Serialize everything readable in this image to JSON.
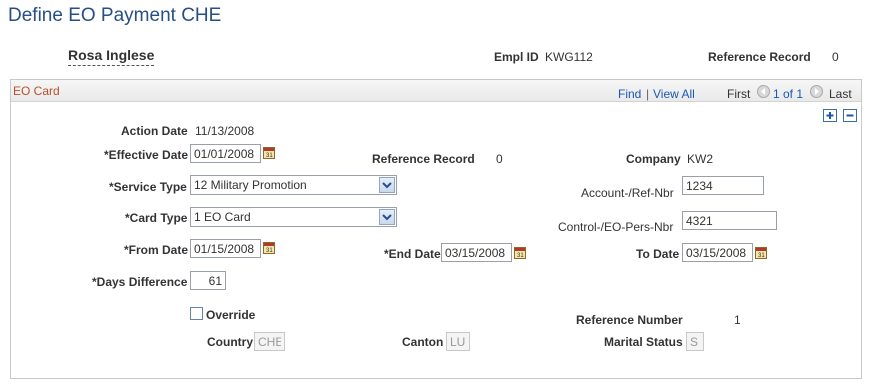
{
  "page": {
    "title": "Define EO Payment CHE"
  },
  "header": {
    "employee_name": "Rosa Inglese",
    "empl_id_label": "Empl ID",
    "empl_id_value": "KWG112",
    "reference_record_label": "Reference Record",
    "reference_record_value": "0"
  },
  "card": {
    "title": "EO Card",
    "find_label": "Find",
    "separator": "|",
    "view_all_label": "View All",
    "first_label": "First",
    "page_info": "1 of 1",
    "last_label": "Last",
    "icons": {
      "prev": "prev-arrow-icon",
      "next": "next-arrow-icon",
      "add": "plus-icon",
      "delete": "minus-icon",
      "calendar": "calendar-icon"
    }
  },
  "form": {
    "action_date": {
      "label": "Action Date",
      "value": "11/13/2008"
    },
    "effective_date": {
      "label": "*Effective Date",
      "value": "01/01/2008"
    },
    "reference_record": {
      "label": "Reference Record",
      "value": "0"
    },
    "company": {
      "label": "Company",
      "value": "KW2"
    },
    "service_type": {
      "label": "*Service Type",
      "value": "12 Military Promotion"
    },
    "account_ref_nbr": {
      "label": "Account-/Ref-Nbr",
      "value": "1234"
    },
    "card_type": {
      "label": "*Card Type",
      "value": "1 EO Card"
    },
    "control_eo_pers_nbr": {
      "label": "Control-/EO-Pers-Nbr",
      "value": "4321"
    },
    "from_date": {
      "label": "*From Date",
      "value": "01/15/2008"
    },
    "end_date": {
      "label": "*End Date",
      "value": "03/15/2008"
    },
    "to_date": {
      "label": "To Date",
      "value": "03/15/2008"
    },
    "days_difference": {
      "label": "*Days Difference",
      "value": "61"
    },
    "override": {
      "label": "Override",
      "checked": false
    },
    "reference_number": {
      "label": "Reference Number",
      "value": "1"
    },
    "country": {
      "label": "Country",
      "value": "CHE"
    },
    "canton": {
      "label": "Canton",
      "value": "LU"
    },
    "marital_status": {
      "label": "Marital Status",
      "value": "S"
    }
  }
}
